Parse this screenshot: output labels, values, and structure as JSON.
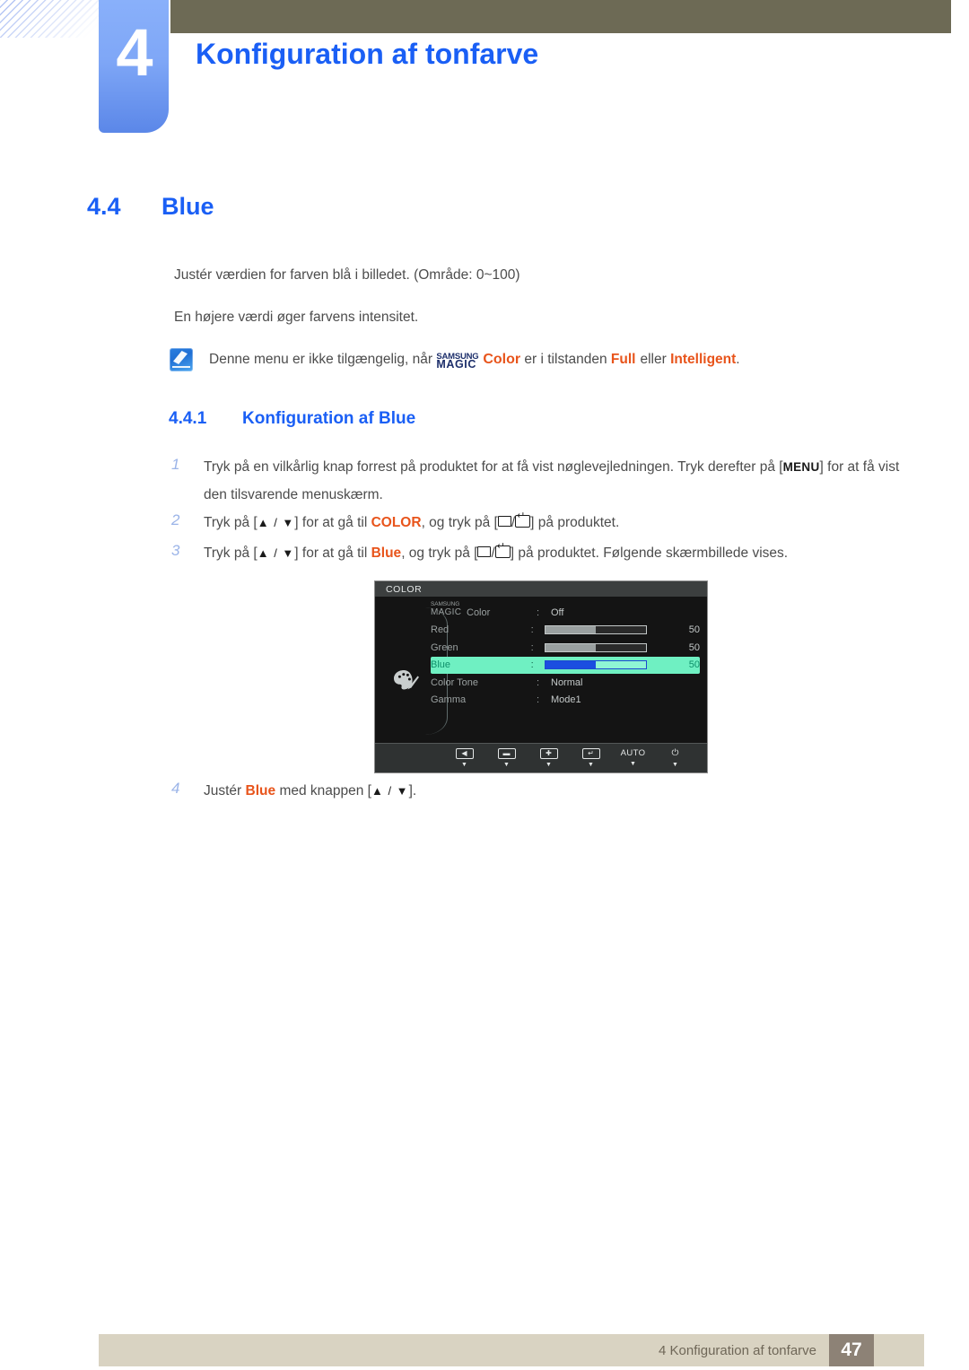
{
  "header": {
    "chapter_number": "4",
    "chapter_title": "Konfiguration af tonfarve"
  },
  "section": {
    "number": "4.4",
    "title": "Blue",
    "paragraph_1": "Justér værdien for farven blå i billedet. (Område: 0~100)",
    "paragraph_2": "En højere værdi øger farvens intensitet."
  },
  "note": {
    "icon": "note-pencil-icon",
    "text_before": "Denne menu er ikke tilgængelig, når",
    "magic_top": "SAMSUNG",
    "magic_bottom": "MAGIC",
    "magic_color": "Color",
    "text_middle": "er i tilstanden",
    "mode_full": "Full",
    "text_or": "eller",
    "mode_intelligent": "Intelligent",
    "period": "."
  },
  "subsection": {
    "number": "4.4.1",
    "title": "Konfiguration af Blue"
  },
  "steps": [
    {
      "number": "1",
      "part_1": "Tryk på en vilkårlig knap forrest på produktet for at få vist nøglevejledningen. Tryk derefter på [",
      "key": "MENU",
      "part_2": "] for at få vist den tilsvarende menuskærm."
    },
    {
      "number": "2",
      "part_1": "Tryk på [",
      "keys": "▲ / ▼",
      "part_2": "] for at gå til",
      "target": "COLOR",
      "part_3": ", og tryk på [",
      "part_4": "] på produktet."
    },
    {
      "number": "3",
      "part_1": "Tryk på [",
      "keys": "▲ / ▼",
      "part_2": "] for at gå til",
      "target": "Blue",
      "part_3": ", og tryk på [",
      "part_4": "] på produktet. Følgende skærmbillede vises."
    },
    {
      "number": "4",
      "part_1": "Justér",
      "target": "Blue",
      "part_2": "med knappen [",
      "keys": "▲ / ▼",
      "part_3": "]."
    }
  ],
  "osd": {
    "title": "COLOR",
    "palette_icon": "palette-icon",
    "rows": [
      {
        "label_top": "SAMSUNG",
        "label_bottom": "MAGIC",
        "label_suffix": "Color",
        "colon": ":",
        "type": "text",
        "value": "Off",
        "selected": false
      },
      {
        "label": "Red",
        "colon": ":",
        "type": "slider",
        "value": "50",
        "fill_percent": 50,
        "selected": false
      },
      {
        "label": "Green",
        "colon": ":",
        "type": "slider",
        "value": "50",
        "fill_percent": 50,
        "selected": false
      },
      {
        "label": "Blue",
        "colon": ":",
        "type": "slider",
        "value": "50",
        "fill_percent": 50,
        "selected": true
      },
      {
        "label": "Color Tone",
        "colon": ":",
        "type": "text",
        "value": "Normal",
        "selected": false
      },
      {
        "label": "Gamma",
        "colon": ":",
        "type": "text",
        "value": "Mode1",
        "selected": false
      }
    ],
    "buttons": [
      {
        "name": "left-arrow-button",
        "glyph": "◀",
        "boxed": true,
        "caret": "▼"
      },
      {
        "name": "minus-button",
        "glyph": "▬",
        "boxed": true,
        "caret": "▼"
      },
      {
        "name": "plus-button",
        "glyph": "✚",
        "boxed": true,
        "caret": "▼"
      },
      {
        "name": "enter-button",
        "glyph": "↵",
        "boxed": true,
        "caret": "▼"
      },
      {
        "name": "auto-button",
        "glyph": "AUTO",
        "boxed": false,
        "caret": "▼"
      },
      {
        "name": "power-button",
        "glyph": "⏻",
        "boxed": false,
        "caret": "▼"
      }
    ],
    "colors": {
      "background": "#141414",
      "titlebar": "#3c3f3f",
      "highlight": "#6ff0c2",
      "slider_fill_selected": "#1b4ee0",
      "slider_fill": "#9aa0a0"
    }
  },
  "footer": {
    "text": "4 Konfiguration af tonfarve",
    "page_number": "47"
  },
  "colors": {
    "heading_blue": "#1a5ff5",
    "accent_orange": "#e8541b",
    "olive_bar": "#6d6a55",
    "tab_blue": "#7fa7f7",
    "footer_bar": "#d9d3c2",
    "footer_page_box": "#8d8276"
  }
}
